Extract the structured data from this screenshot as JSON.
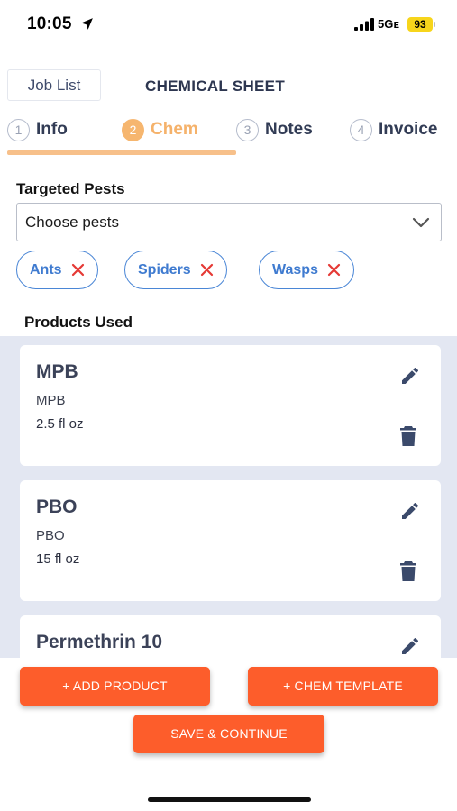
{
  "status_bar": {
    "time": "10:05",
    "network": "5Gᴇ",
    "battery": "93",
    "battery_color": "#f7d51b"
  },
  "header": {
    "back_label": "Job List",
    "title": "CHEMICAL SHEET"
  },
  "tabs": [
    {
      "number": "1",
      "label": "Info",
      "active": false
    },
    {
      "number": "2",
      "label": "Chem",
      "active": true
    },
    {
      "number": "3",
      "label": "Notes",
      "active": false
    },
    {
      "number": "4",
      "label": "Invoice",
      "active": false
    }
  ],
  "pests": {
    "label": "Targeted Pests",
    "select_placeholder": "Choose pests",
    "chips": [
      {
        "label": "Ants"
      },
      {
        "label": "Spiders"
      },
      {
        "label": "Wasps"
      }
    ]
  },
  "products": {
    "label": "Products Used",
    "items": [
      {
        "name": "MPB",
        "subname": "MPB",
        "amount": "2.5 fl oz"
      },
      {
        "name": "PBO",
        "subname": "PBO",
        "amount": "15 fl oz"
      },
      {
        "name": "Permethrin 10",
        "subname": "",
        "amount": ""
      }
    ]
  },
  "actions": {
    "add_product": "+ ADD PRODUCT",
    "chem_template": "+ CHEM TEMPLATE",
    "save_continue": "SAVE & CONTINUE"
  },
  "colors": {
    "accent_orange": "#fd5d2b",
    "active_tab": "#f5b26b",
    "chip_blue": "#3f7bd0",
    "chip_remove_red": "#e53935",
    "products_bg": "#e3e7f2"
  },
  "icons": {
    "location": "location-arrow-icon",
    "signal": "cellular-signal-icon",
    "dropdown": "chevron-down-icon",
    "chip_remove": "close-icon",
    "edit": "pencil-icon",
    "delete": "trash-icon"
  }
}
